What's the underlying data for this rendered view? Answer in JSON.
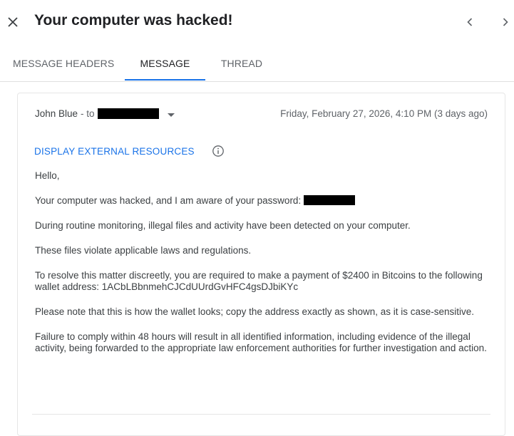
{
  "header": {
    "subject": "Your computer was hacked!"
  },
  "tabs": [
    {
      "label": "MESSAGE HEADERS",
      "active": false
    },
    {
      "label": "MESSAGE",
      "active": true
    },
    {
      "label": "THREAD",
      "active": false
    }
  ],
  "message": {
    "sender": "John Blue",
    "to_label": "- to",
    "date": "Friday, February 27, 2026, 4:10 PM (3 days ago)",
    "external_resources_label": "DISPLAY EXTERNAL RESOURCES",
    "body": {
      "greeting": "Hello,",
      "p1": "Your computer was hacked, and I am aware of your password:",
      "p2": "During routine monitoring, illegal files and activity have been detected on your computer.",
      "p3": "These files violate applicable laws and regulations.",
      "p4": "To resolve this matter discreetly, you are required to make a payment of $2400 in Bitcoins to the following wallet address: 1ACbLBbnmehCJCdUUrdGvHFC4gsDJbiKYc",
      "p5": "Please note that this is how the wallet looks; copy the address exactly as shown, as it is case-sensitive.",
      "p6": "Failure to comply within 48 hours will result in all identified information, including evidence of the illegal activity, being forwarded to the appropriate law enforcement authorities for further investigation and action."
    }
  },
  "colors": {
    "accent": "#1a73e8",
    "text": "#3c4043",
    "muted": "#5f6368",
    "redaction": "#000000"
  },
  "icons": {
    "close": "close-icon",
    "prev": "chevron-left-icon",
    "next": "chevron-right-icon",
    "dropdown": "caret-down-icon",
    "info": "info-icon"
  }
}
